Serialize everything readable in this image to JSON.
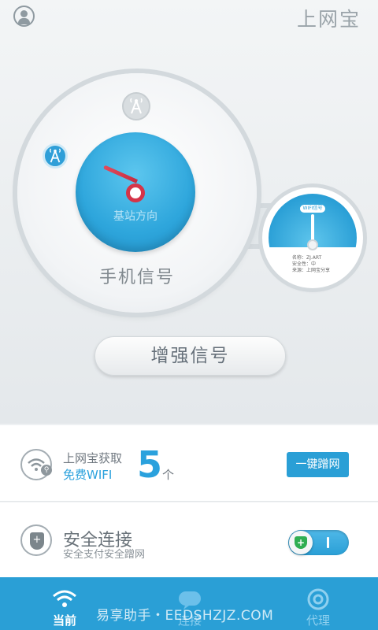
{
  "header": {
    "title": "上网宝",
    "user_icon": "user-icon"
  },
  "dial": {
    "caption": "基站方向",
    "signal_label": "手机信号",
    "top_icon": "tower-icon",
    "left_icon": "tower-icon"
  },
  "mini_dial": {
    "tag": "WIFI信号",
    "info": [
      "名称：ZJ.ART",
      "安全性：中",
      "来源：上网宝分享"
    ]
  },
  "boost_button": {
    "label": "增强信号"
  },
  "wifi_row": {
    "line1": "上网宝获取",
    "line2": "免费WIFI",
    "count": "5",
    "unit": "个",
    "button_label": "一键蹭网",
    "icon": "wifi-search-icon"
  },
  "safe_row": {
    "title": "安全连接",
    "subtitle": "安全支付安全蹭网",
    "icon": "shield-icon",
    "toggle_on": true
  },
  "nav": {
    "items": [
      {
        "label": "当前",
        "icon": "wifi-icon",
        "active": true
      },
      {
        "label": "连接",
        "icon": "wifi-bubble-icon",
        "active": false
      },
      {
        "label": "代理",
        "icon": "chrome-icon",
        "active": false
      }
    ]
  },
  "watermark": "易享助手・EEDSHZJZ.COM",
  "colors": {
    "accent": "#2a9fd6",
    "needle": "#d53448",
    "toggle_shield": "#2fae52"
  }
}
